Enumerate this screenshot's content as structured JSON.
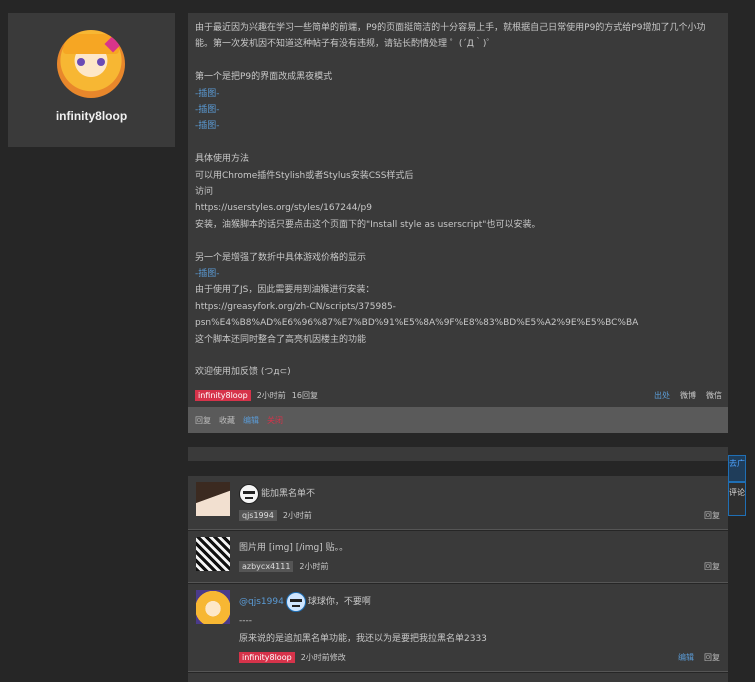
{
  "profile": {
    "username": "infinity8loop"
  },
  "post": {
    "lines": [
      "由于最近因为兴趣在学习一些简单的前端，P9的页面挺简洁的十分容易上手，就根据自己日常使用P9的方式给P9增加了几个小功",
      "能。第一次发机因不知道这种帖子有没有违规，请钻长酌情处理 ゜(´Д｀)゜",
      "",
      "第一个是把P9的界面改成黑夜模式",
      "-插图-",
      "-插图-",
      "-插图-",
      "",
      "具体使用方法",
      "可以用Chrome插件Stylish或者Stylus安装CSS样式后",
      "访问",
      "https://userstyles.org/styles/167244/p9",
      "安装，油猴脚本的话只要点击这个页面下的\"Install style as userscript\"也可以安装。",
      "",
      "另一个是增强了数折中具体游戏价格的显示",
      "-插图-",
      "由于使用了JS，因此需要用到油猴进行安装：",
      "https://greasyfork.org/zh-CN/scripts/375985-",
      "psn%E4%B8%AD%E6%96%87%E7%BD%91%E5%8A%9F%E8%83%BD%E5%A2%9E%E5%BC%BA",
      "这个脚本还同时整合了高亮机因楼主的功能",
      "",
      "欢迎使用加反馈 (つд⊂)"
    ],
    "author_tag": "infinity8loop",
    "time": "2小时前",
    "replies": "16回复",
    "share": [
      "出处",
      "微博",
      "微信"
    ]
  },
  "actions": [
    "回复",
    "收藏",
    "编辑",
    "关闭"
  ],
  "side_tabs": [
    "去广",
    "评论"
  ],
  "comments": [
    {
      "text": "能加黑名单不",
      "user": "qjs1994",
      "time": "2小时前",
      "right": [
        "回复"
      ]
    },
    {
      "text": "图片用 [img] [/img] 贴。。",
      "user": "azbycx4111",
      "time": "2小时前",
      "right": [
        "回复"
      ]
    },
    {
      "mention": "@qjs1994",
      "text": "球球你，不要啊",
      "line2": "----",
      "line3": "原来说的是追加黑名单功能，我还以为是要把我拉黑名单2333",
      "user": "infinity8loop",
      "time": "2小时前修改",
      "right": [
        "编辑",
        "回复"
      ]
    }
  ],
  "colors": {
    "accent_red": "#d6334a",
    "link_blue": "#5b9bd5",
    "panel": "#3a3a3a",
    "bg": "#262626"
  }
}
